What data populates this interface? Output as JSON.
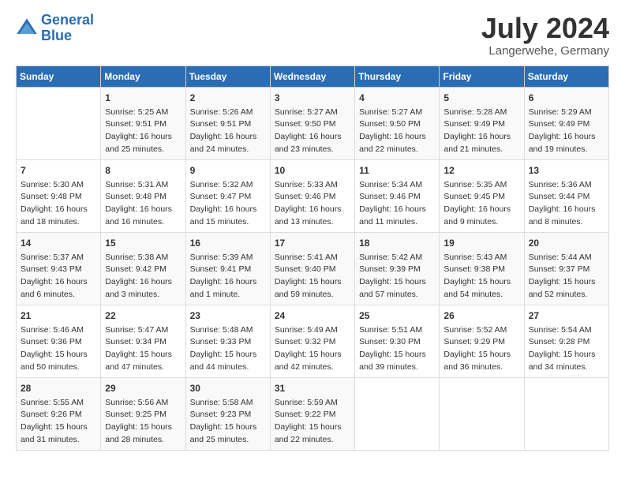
{
  "header": {
    "logo_line1": "General",
    "logo_line2": "Blue",
    "month_year": "July 2024",
    "location": "Langerwehe, Germany"
  },
  "calendar": {
    "days_of_week": [
      "Sunday",
      "Monday",
      "Tuesday",
      "Wednesday",
      "Thursday",
      "Friday",
      "Saturday"
    ],
    "weeks": [
      [
        {
          "day": "",
          "content": ""
        },
        {
          "day": "1",
          "content": "Sunrise: 5:25 AM\nSunset: 9:51 PM\nDaylight: 16 hours\nand 25 minutes."
        },
        {
          "day": "2",
          "content": "Sunrise: 5:26 AM\nSunset: 9:51 PM\nDaylight: 16 hours\nand 24 minutes."
        },
        {
          "day": "3",
          "content": "Sunrise: 5:27 AM\nSunset: 9:50 PM\nDaylight: 16 hours\nand 23 minutes."
        },
        {
          "day": "4",
          "content": "Sunrise: 5:27 AM\nSunset: 9:50 PM\nDaylight: 16 hours\nand 22 minutes."
        },
        {
          "day": "5",
          "content": "Sunrise: 5:28 AM\nSunset: 9:49 PM\nDaylight: 16 hours\nand 21 minutes."
        },
        {
          "day": "6",
          "content": "Sunrise: 5:29 AM\nSunset: 9:49 PM\nDaylight: 16 hours\nand 19 minutes."
        }
      ],
      [
        {
          "day": "7",
          "content": "Sunrise: 5:30 AM\nSunset: 9:48 PM\nDaylight: 16 hours\nand 18 minutes."
        },
        {
          "day": "8",
          "content": "Sunrise: 5:31 AM\nSunset: 9:48 PM\nDaylight: 16 hours\nand 16 minutes."
        },
        {
          "day": "9",
          "content": "Sunrise: 5:32 AM\nSunset: 9:47 PM\nDaylight: 16 hours\nand 15 minutes."
        },
        {
          "day": "10",
          "content": "Sunrise: 5:33 AM\nSunset: 9:46 PM\nDaylight: 16 hours\nand 13 minutes."
        },
        {
          "day": "11",
          "content": "Sunrise: 5:34 AM\nSunset: 9:46 PM\nDaylight: 16 hours\nand 11 minutes."
        },
        {
          "day": "12",
          "content": "Sunrise: 5:35 AM\nSunset: 9:45 PM\nDaylight: 16 hours\nand 9 minutes."
        },
        {
          "day": "13",
          "content": "Sunrise: 5:36 AM\nSunset: 9:44 PM\nDaylight: 16 hours\nand 8 minutes."
        }
      ],
      [
        {
          "day": "14",
          "content": "Sunrise: 5:37 AM\nSunset: 9:43 PM\nDaylight: 16 hours\nand 6 minutes."
        },
        {
          "day": "15",
          "content": "Sunrise: 5:38 AM\nSunset: 9:42 PM\nDaylight: 16 hours\nand 3 minutes."
        },
        {
          "day": "16",
          "content": "Sunrise: 5:39 AM\nSunset: 9:41 PM\nDaylight: 16 hours\nand 1 minute."
        },
        {
          "day": "17",
          "content": "Sunrise: 5:41 AM\nSunset: 9:40 PM\nDaylight: 15 hours\nand 59 minutes."
        },
        {
          "day": "18",
          "content": "Sunrise: 5:42 AM\nSunset: 9:39 PM\nDaylight: 15 hours\nand 57 minutes."
        },
        {
          "day": "19",
          "content": "Sunrise: 5:43 AM\nSunset: 9:38 PM\nDaylight: 15 hours\nand 54 minutes."
        },
        {
          "day": "20",
          "content": "Sunrise: 5:44 AM\nSunset: 9:37 PM\nDaylight: 15 hours\nand 52 minutes."
        }
      ],
      [
        {
          "day": "21",
          "content": "Sunrise: 5:46 AM\nSunset: 9:36 PM\nDaylight: 15 hours\nand 50 minutes."
        },
        {
          "day": "22",
          "content": "Sunrise: 5:47 AM\nSunset: 9:34 PM\nDaylight: 15 hours\nand 47 minutes."
        },
        {
          "day": "23",
          "content": "Sunrise: 5:48 AM\nSunset: 9:33 PM\nDaylight: 15 hours\nand 44 minutes."
        },
        {
          "day": "24",
          "content": "Sunrise: 5:49 AM\nSunset: 9:32 PM\nDaylight: 15 hours\nand 42 minutes."
        },
        {
          "day": "25",
          "content": "Sunrise: 5:51 AM\nSunset: 9:30 PM\nDaylight: 15 hours\nand 39 minutes."
        },
        {
          "day": "26",
          "content": "Sunrise: 5:52 AM\nSunset: 9:29 PM\nDaylight: 15 hours\nand 36 minutes."
        },
        {
          "day": "27",
          "content": "Sunrise: 5:54 AM\nSunset: 9:28 PM\nDaylight: 15 hours\nand 34 minutes."
        }
      ],
      [
        {
          "day": "28",
          "content": "Sunrise: 5:55 AM\nSunset: 9:26 PM\nDaylight: 15 hours\nand 31 minutes."
        },
        {
          "day": "29",
          "content": "Sunrise: 5:56 AM\nSunset: 9:25 PM\nDaylight: 15 hours\nand 28 minutes."
        },
        {
          "day": "30",
          "content": "Sunrise: 5:58 AM\nSunset: 9:23 PM\nDaylight: 15 hours\nand 25 minutes."
        },
        {
          "day": "31",
          "content": "Sunrise: 5:59 AM\nSunset: 9:22 PM\nDaylight: 15 hours\nand 22 minutes."
        },
        {
          "day": "",
          "content": ""
        },
        {
          "day": "",
          "content": ""
        },
        {
          "day": "",
          "content": ""
        }
      ]
    ]
  }
}
